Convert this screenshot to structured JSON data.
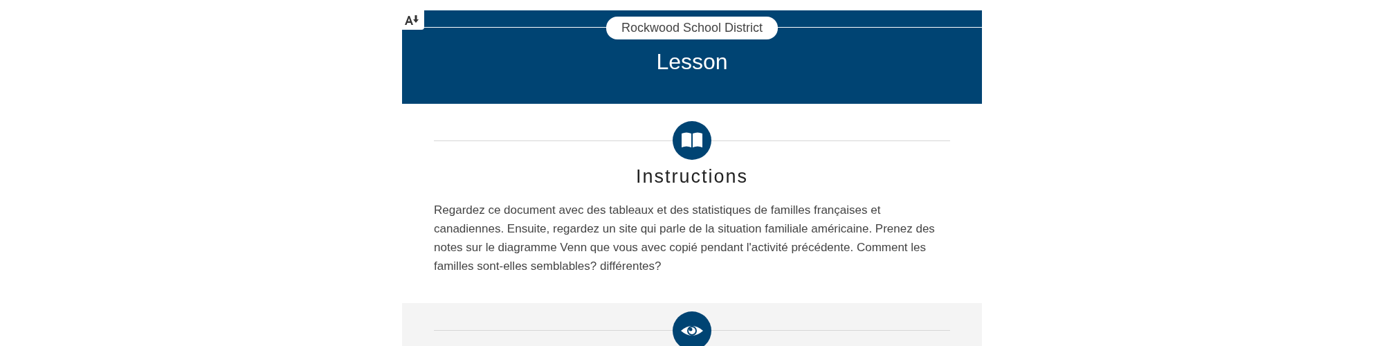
{
  "header": {
    "district": "Rockwood School District",
    "title": "Lesson"
  },
  "sections": [
    {
      "kind": "book",
      "shaded": false,
      "heading": "Instructions",
      "paragraph": "Regardez ce document avec des tableaux et des statistiques de familles françaises et canadiennes. Ensuite, regardez un site qui parle de la situation familiale américaine. Prenez des notes sur le diagramme Venn que vous avec copié pendant l'activité précédente. Comment les familles sont-elles semblables? différentes?"
    },
    {
      "kind": "eye",
      "shaded": true
    }
  ]
}
